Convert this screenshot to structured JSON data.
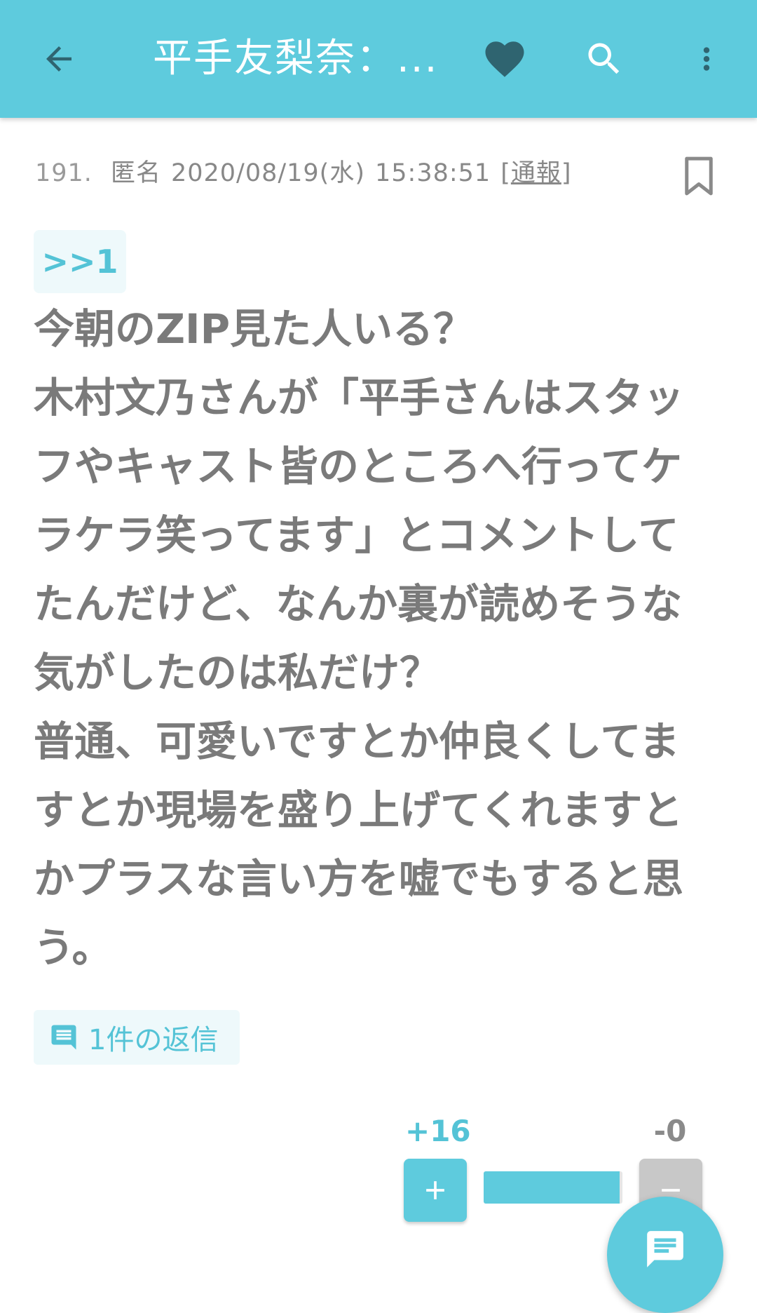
{
  "header": {
    "title": "平手友梨奈：...",
    "icons": [
      "arrow-left-icon",
      "heart-icon",
      "search-icon",
      "more-vertical-icon"
    ],
    "bar_color": "#5ecbdd"
  },
  "post": {
    "number": "191.",
    "author": "匿名",
    "date": "2020/08/19(水)",
    "time": "15:38:51",
    "report_open": "[",
    "report_label": "通報",
    "report_close": "]",
    "anchor": ">>1",
    "body": "今朝のZIP見た人いる？\n木村文乃さんが「平手さんはスタッフやキャスト皆のところへ行ってケラケラ笑ってます」とコメントしてたんだけど、なんか裏が読めそうな気がしたのは私だけ？\n普通、可愛いですとか仲良くしてますとか現場を盛り上げてくれますとかプラスな言い方を嘘でもすると思う。",
    "reply_label": "1件の返信"
  },
  "votes": {
    "plus": "+16",
    "minus": "-0",
    "plus_fraction": 0.98
  },
  "colors": {
    "accent": "#5ecbdd",
    "heart": "#2f6470",
    "text": "#7a7a7a",
    "chip_bg": "#eef9fb"
  }
}
